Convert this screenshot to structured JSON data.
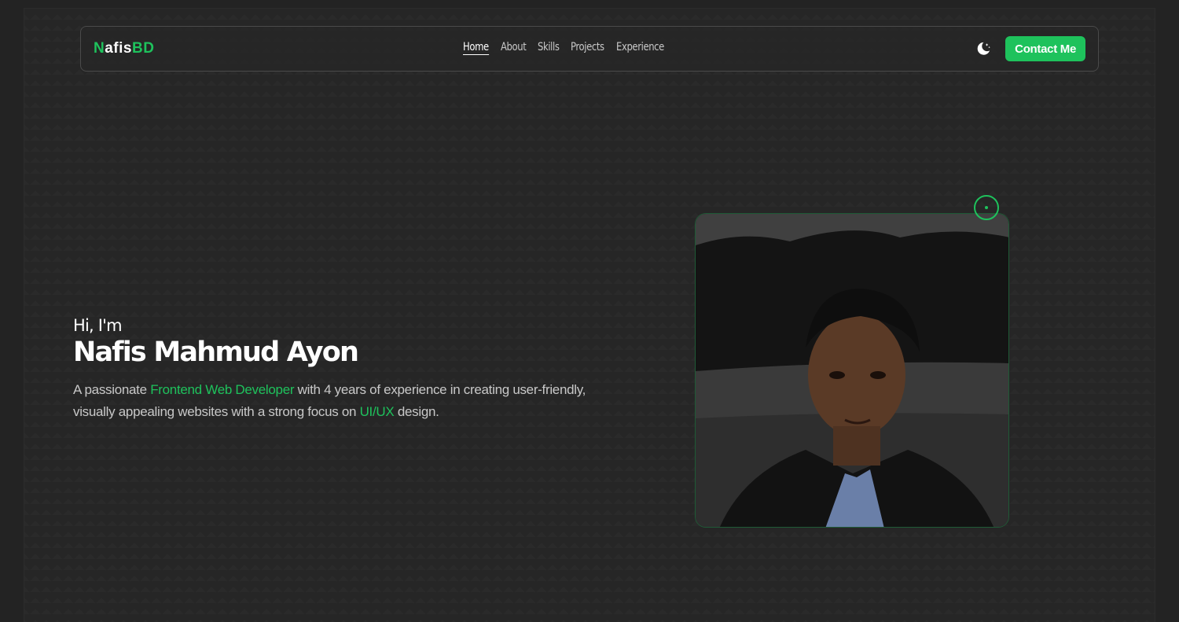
{
  "brand": {
    "logo_first": "N",
    "logo_mid": "afis",
    "logo_last": "BD",
    "accent_color": "#1ec25c"
  },
  "nav": {
    "items": [
      {
        "label": "Home",
        "active": true
      },
      {
        "label": "About",
        "active": false
      },
      {
        "label": "Skills",
        "active": false
      },
      {
        "label": "Projects",
        "active": false
      },
      {
        "label": "Experience",
        "active": false
      }
    ],
    "theme_toggle_icon": "moon-stars-icon",
    "contact_label": "Contact Me"
  },
  "hero": {
    "greeting": "Hi, I'm",
    "name": "Nafis Mahmud Ayon",
    "desc_part1": "A passionate ",
    "desc_highlight1": "Frontend Web Developer",
    "desc_part2": " with 4 years of experience in creating user-friendly, visually appealing websites with a strong focus on ",
    "desc_highlight2": "UI/UX",
    "desc_part3": " design."
  },
  "profile_photo": {
    "icon": "profile-photo",
    "decor_icon": "orbit-dot-icon"
  }
}
